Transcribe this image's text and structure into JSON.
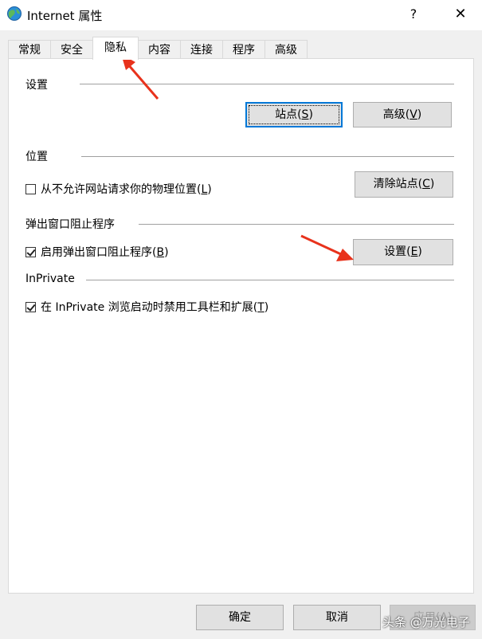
{
  "window": {
    "title": "Internet 属性",
    "help_label": "?",
    "close_label": "✕"
  },
  "tabs": [
    {
      "label": "常规"
    },
    {
      "label": "安全"
    },
    {
      "label": "隐私",
      "active": true
    },
    {
      "label": "内容"
    },
    {
      "label": "连接"
    },
    {
      "label": "程序"
    },
    {
      "label": "高级"
    }
  ],
  "settings_section": {
    "label": "设置",
    "sites_button": {
      "text": "站点(",
      "mnemonic": "S",
      "close": ")"
    },
    "advanced_button": {
      "text": "高级(",
      "mnemonic": "V",
      "close": ")"
    }
  },
  "location_section": {
    "label": "位置",
    "checkbox": {
      "text": "从不允许网站请求你的物理位置(",
      "mnemonic": "L",
      "close": ")",
      "checked": false
    },
    "clear_button": {
      "text": "清除站点(",
      "mnemonic": "C",
      "close": ")"
    }
  },
  "popup_section": {
    "label": "弹出窗口阻止程序",
    "checkbox": {
      "text": "启用弹出窗口阻止程序(",
      "mnemonic": "B",
      "close": ")",
      "checked": true
    },
    "settings_button": {
      "text": "设置(",
      "mnemonic": "E",
      "close": ")"
    }
  },
  "inprivate_section": {
    "label": "InPrivate",
    "checkbox": {
      "text": "在 InPrivate 浏览启动时禁用工具栏和扩展(",
      "mnemonic": "T",
      "close": ")",
      "checked": true
    }
  },
  "footer": {
    "ok_label": "确定",
    "cancel_label": "取消",
    "apply_label": "应用(A)"
  },
  "watermark": "头条 @万光电子",
  "colors": {
    "accent": "#0078d7",
    "annotation_arrow": "#e8321c"
  }
}
